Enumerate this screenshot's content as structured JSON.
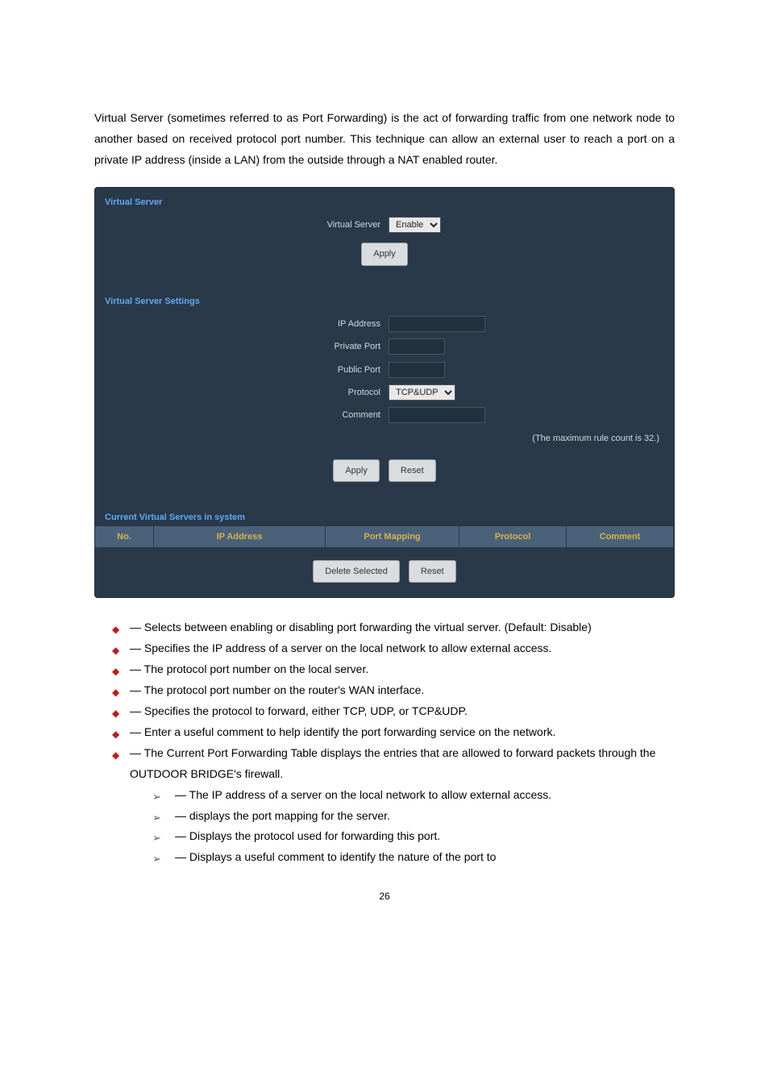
{
  "intro": "Virtual Server (sometimes referred to as Port Forwarding) is the act of forwarding traffic from one network node to another based on received protocol port number. This technique can allow an external user to reach a port on a private IP address (inside a LAN) from the outside through a NAT enabled router.",
  "panel": {
    "section1_title": "Virtual Server",
    "vs_label": "Virtual Server",
    "vs_select": "Enable",
    "apply1_label": "Apply",
    "section2_title": "Virtual Server Settings",
    "ip_label": "IP Address",
    "private_port_label": "Private Port",
    "public_port_label": "Public Port",
    "protocol_label": "Protocol",
    "protocol_select": "TCP&UDP",
    "comment_label": "Comment",
    "hint": "(The maximum rule count is 32.)",
    "apply2_label": "Apply",
    "reset2_label": "Reset",
    "section3_title": "Current Virtual Servers in system",
    "th_no": "No.",
    "th_ip": "IP Address",
    "th_portmap": "Port Mapping",
    "th_protocol": "Protocol",
    "th_comment": "Comment",
    "delete_sel_label": "Delete Selected",
    "reset3_label": "Reset"
  },
  "bullets": {
    "b1": " — Selects between enabling or disabling port forwarding the virtual server. (Default: Disable)",
    "b2": " — Specifies the IP address of a server on the local network to allow external access.",
    "b3": " — The protocol port number on the local server.",
    "b4": " — The protocol port number on the router's WAN interface.",
    "b5": " — Specifies the protocol to forward, either TCP, UDP, or TCP&UDP.",
    "b6": " — Enter a useful comment to help identify the port forwarding service on the network.",
    "b7": " — The Current Port Forwarding Table displays the entries that are allowed to forward packets through the OUTDOOR BRIDGE's firewall.",
    "s1": " — The IP address of a server on the local network to allow external access.",
    "s2": " — displays the port mapping for the server.",
    "s3": " — Displays the protocol used for forwarding this port.",
    "s4": " — Displays a useful comment to identify the nature of the port to"
  },
  "page_number": "26"
}
